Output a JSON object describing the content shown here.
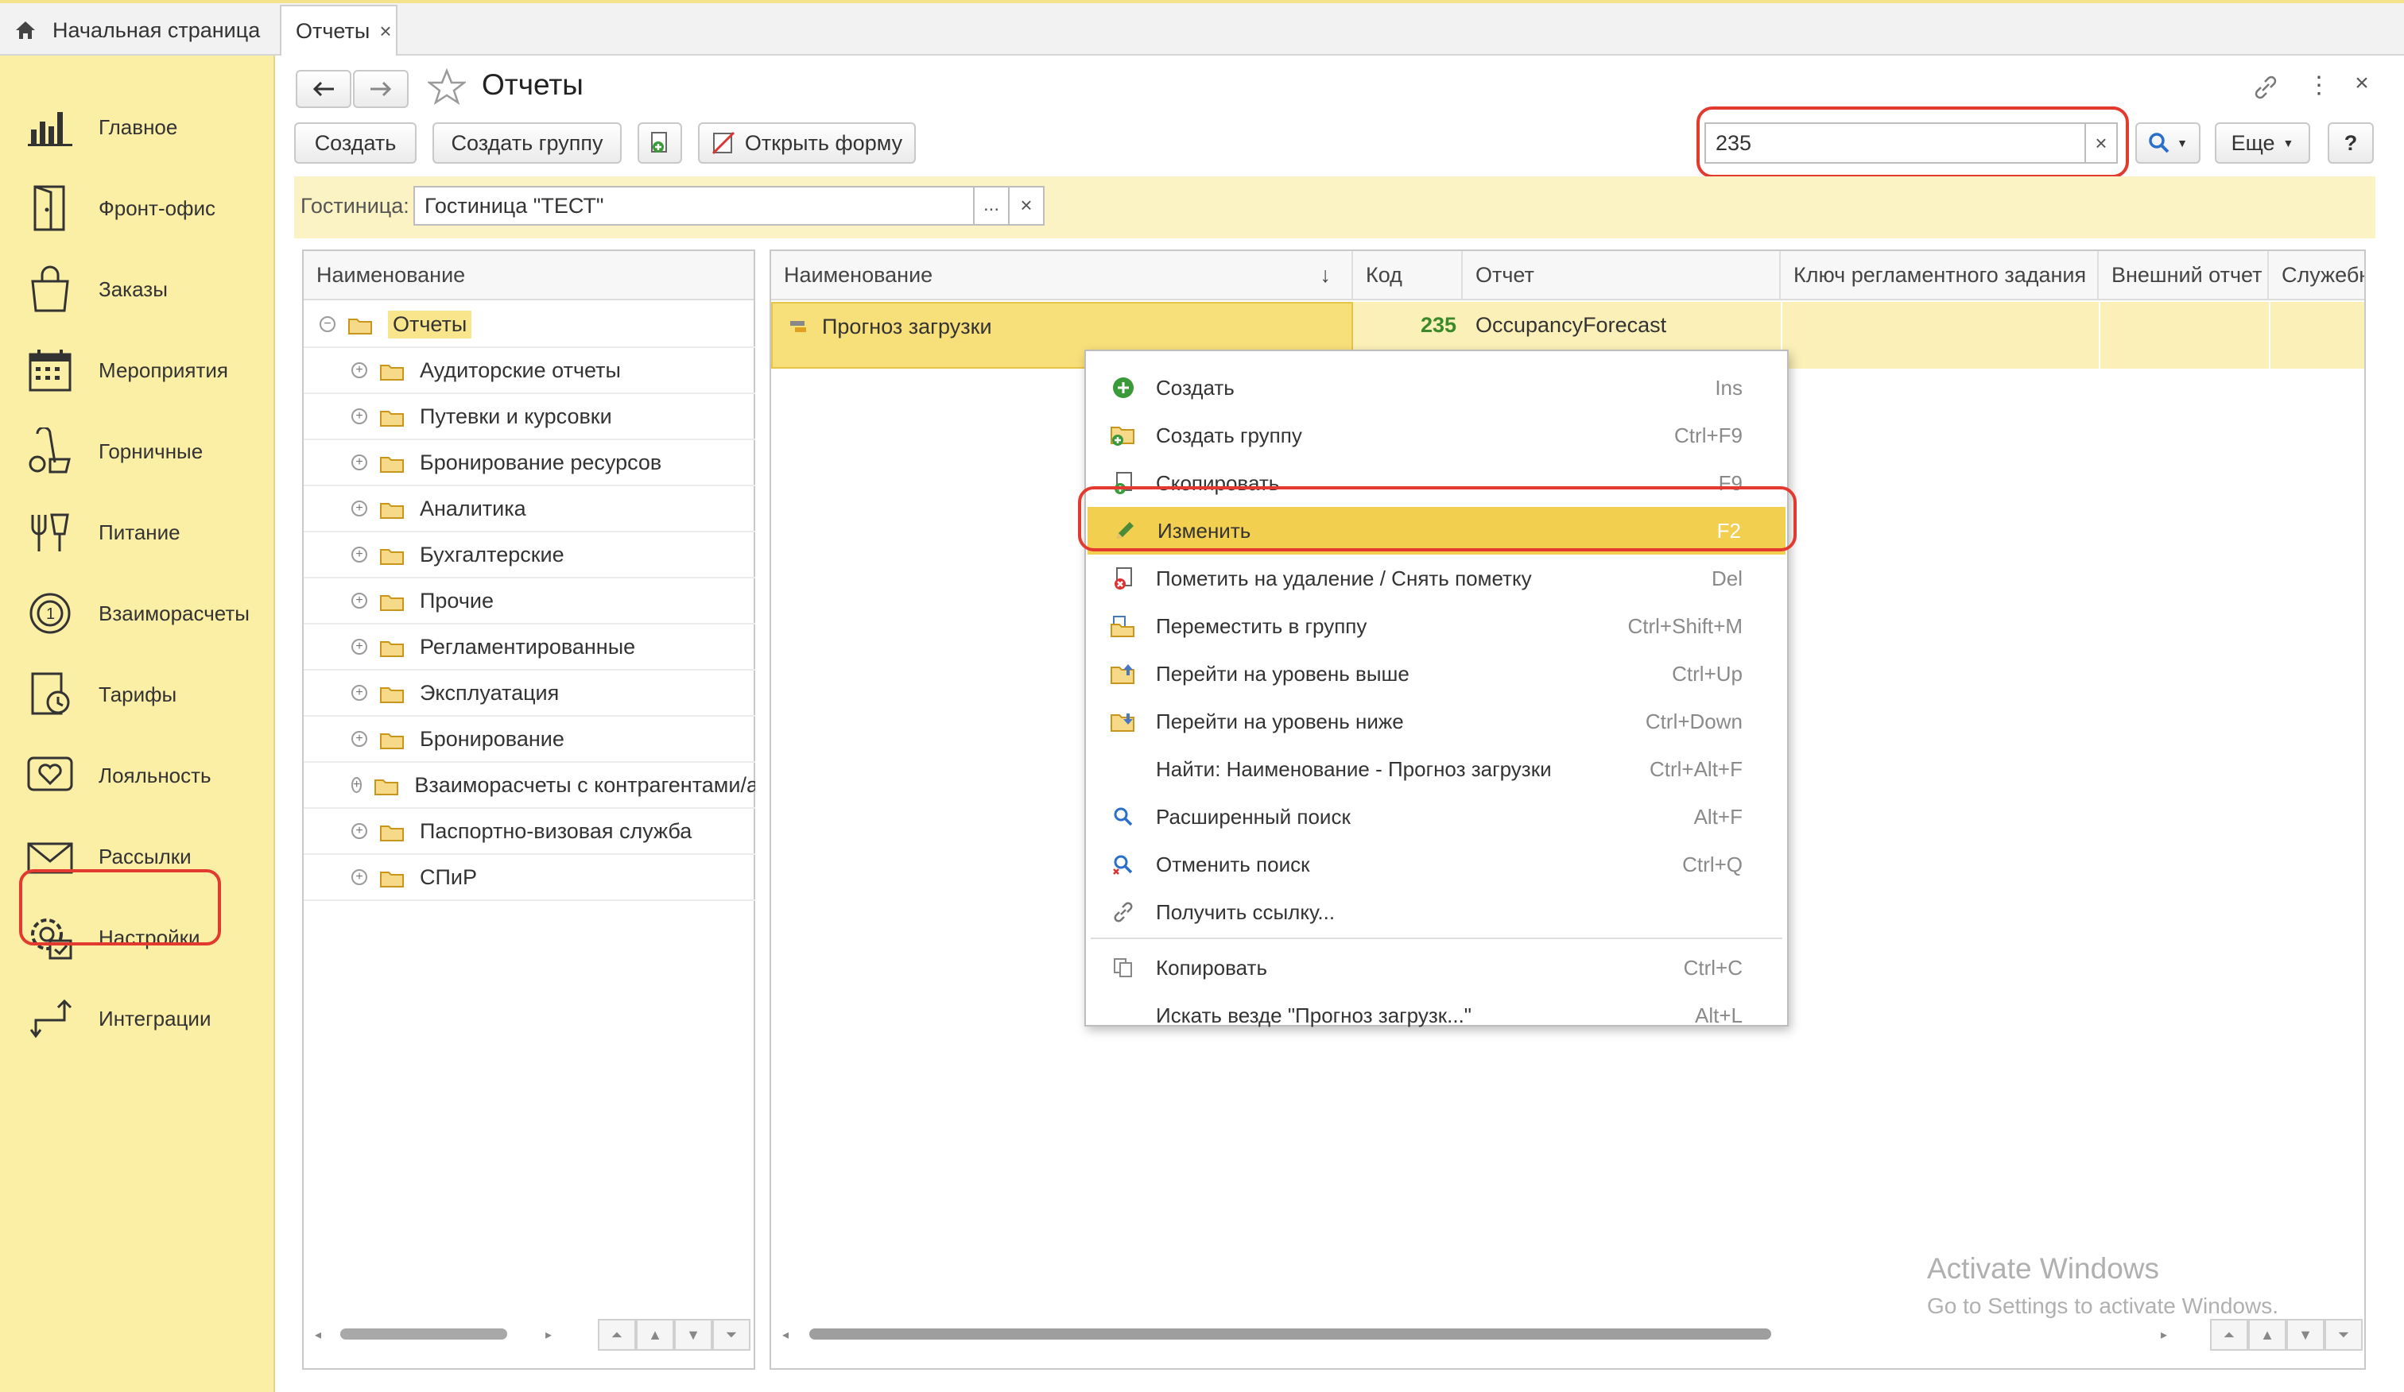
{
  "tabs": {
    "home_label": "Начальная страница",
    "active_label": "Отчеты",
    "close_glyph": "×"
  },
  "sidebar": {
    "items": [
      {
        "label": "Главное",
        "icon": "bar-chart-icon"
      },
      {
        "label": "Фронт-офис",
        "icon": "door-icon"
      },
      {
        "label": "Заказы",
        "icon": "shopping-bag-icon"
      },
      {
        "label": "Мероприятия",
        "icon": "calendar-icon"
      },
      {
        "label": "Горничные",
        "icon": "vacuum-icon"
      },
      {
        "label": "Питание",
        "icon": "food-icon"
      },
      {
        "label": "Взаиморасчеты",
        "icon": "settlement-icon"
      },
      {
        "label": "Тарифы",
        "icon": "tariff-icon"
      },
      {
        "label": "Лояльность",
        "icon": "heart-icon"
      },
      {
        "label": "Рассылки",
        "icon": "mail-icon"
      },
      {
        "label": "Настройки",
        "icon": "settings-icon"
      },
      {
        "label": "Интеграции",
        "icon": "integration-icon"
      }
    ]
  },
  "header": {
    "title": "Отчеты",
    "create": "Создать",
    "create_group": "Создать группу",
    "open_form": "Открыть форму",
    "search_value": "235",
    "search_clear": "×",
    "more": "Еще",
    "help": "?"
  },
  "filter": {
    "label": "Гостиница:",
    "value": "Гостиница \"ТЕСТ\"",
    "select_btn": "...",
    "clear_btn": "×"
  },
  "tree": {
    "header": "Наименование",
    "root": "Отчеты",
    "items": [
      "Аудиторские отчеты",
      "Путевки и курсовки",
      "Бронирование ресурсов",
      "Аналитика",
      "Бухгалтерские",
      "Прочие",
      "Регламентированные",
      "Эксплуатация",
      "Бронирование",
      "Взаиморасчеты с контрагентами/агентами",
      "Паспортно-визовая служба",
      "СПиР"
    ]
  },
  "list": {
    "columns": [
      "Наименование",
      "Код",
      "Отчет",
      "Ключ регламентного задания",
      "Внешний отчет",
      "Служебный"
    ],
    "sort_glyph": "↓",
    "rows": [
      {
        "name": "Прогноз загрузки",
        "code": "235",
        "report": "OccupancyForecast",
        "key": "",
        "external": "",
        "service": ""
      }
    ]
  },
  "context_menu": {
    "items": [
      {
        "label": "Создать",
        "key": "Ins",
        "icon": "add-icon"
      },
      {
        "label": "Создать группу",
        "key": "Ctrl+F9",
        "icon": "add-folder-icon"
      },
      {
        "label": "Скопировать",
        "key": "F9",
        "icon": "copy-item-icon"
      },
      {
        "label": "Изменить",
        "key": "F2",
        "icon": "pencil-icon"
      },
      {
        "label": "Пометить на удаление / Снять пометку",
        "key": "Del",
        "icon": "delete-mark-icon"
      },
      {
        "label": "Переместить в группу",
        "key": "Ctrl+Shift+M",
        "icon": "move-to-group-icon"
      },
      {
        "label": "Перейти на уровень выше",
        "key": "Ctrl+Up",
        "icon": "level-up-icon"
      },
      {
        "label": "Перейти на уровень ниже",
        "key": "Ctrl+Down",
        "icon": "level-down-icon"
      },
      {
        "label": "Найти: Наименование - Прогноз загрузки",
        "key": "Ctrl+Alt+F",
        "icon": ""
      },
      {
        "label": "Расширенный поиск",
        "key": "Alt+F",
        "icon": "advanced-search-icon"
      },
      {
        "label": "Отменить поиск",
        "key": "Ctrl+Q",
        "icon": "cancel-search-icon"
      },
      {
        "label": "Получить ссылку...",
        "key": "",
        "icon": "link-icon"
      },
      {
        "label": "Копировать",
        "key": "Ctrl+C",
        "icon": "copy-icon"
      },
      {
        "label": "Искать везде \"Прогноз загрузк...\"",
        "key": "Alt+L",
        "icon": ""
      }
    ]
  },
  "watermark": {
    "line1": "Activate Windows",
    "line2": "Go to Settings to activate Windows."
  },
  "colors": {
    "sidebar_bg": "#fbeea5",
    "highlight_yellow": "#f3cf4f",
    "annotation_red": "#e23a2f",
    "code_green": "#3a8a2a"
  }
}
